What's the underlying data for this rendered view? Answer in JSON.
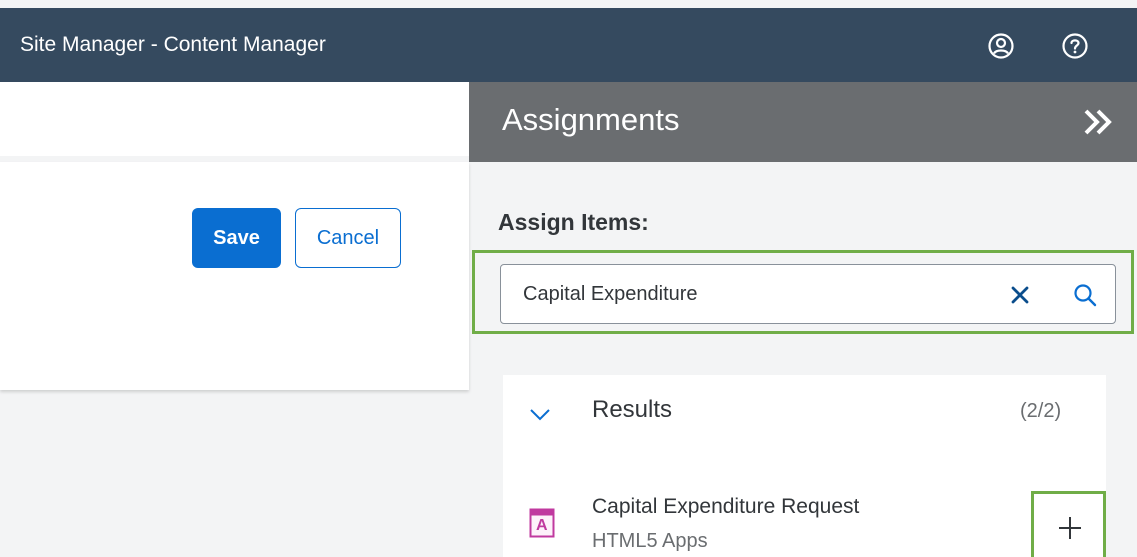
{
  "header": {
    "title": "Site Manager - Content Manager",
    "icons": [
      "user-profile-icon",
      "help-icon"
    ]
  },
  "toolbar": {
    "save_label": "Save",
    "cancel_label": "Cancel"
  },
  "panel": {
    "title": "Assignments",
    "assign_label": "Assign Items:",
    "search": {
      "value": "Capital Expenditure"
    },
    "results": {
      "label": "Results",
      "count": "(2/2)",
      "items": [
        {
          "title": "Capital Expenditure Request",
          "subtitle": "HTML5 Apps",
          "icon_letter": "A"
        }
      ]
    }
  },
  "colors": {
    "shell": "#354a5f",
    "panel_header": "#6a6d70",
    "accent": "#0a6ed1",
    "highlight": "#70ad47",
    "app_icon": "#c0399f"
  }
}
